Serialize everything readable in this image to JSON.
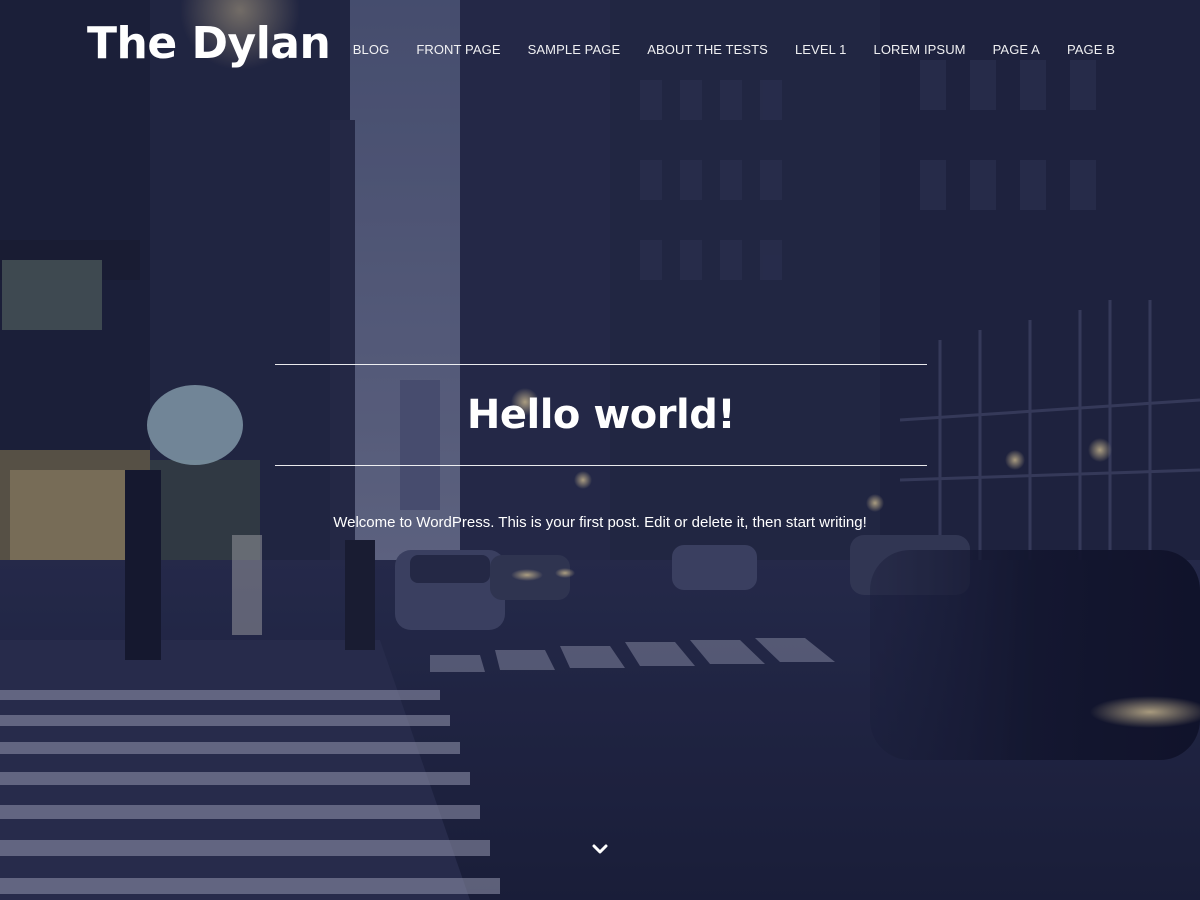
{
  "site": {
    "title": "The Dylan"
  },
  "nav": {
    "items": [
      {
        "label": "BLOG"
      },
      {
        "label": "FRONT PAGE"
      },
      {
        "label": "SAMPLE PAGE"
      },
      {
        "label": "ABOUT THE TESTS"
      },
      {
        "label": "LEVEL 1"
      },
      {
        "label": "LOREM IPSUM"
      },
      {
        "label": "PAGE A"
      },
      {
        "label": "PAGE B"
      }
    ]
  },
  "post": {
    "title": "Hello world!",
    "excerpt": "Welcome to WordPress. This is your first post. Edit or delete it, then start writing!"
  },
  "icons": {
    "scroll": "chevron-down-icon"
  },
  "colors": {
    "overlay": "#161a3c",
    "text": "#ffffff"
  }
}
